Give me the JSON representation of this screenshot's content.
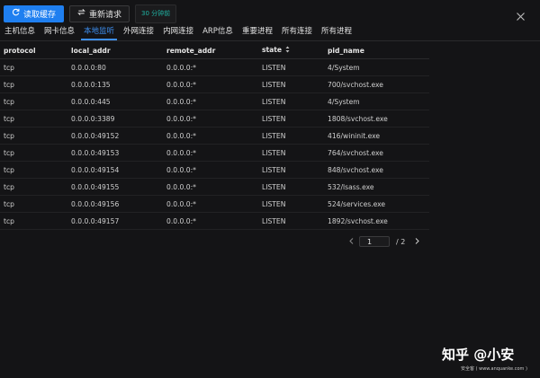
{
  "toolbar": {
    "read_cache_label": "读取缓存",
    "resend_label": "重新请求",
    "time_badge": "30 分钟前"
  },
  "tabs": [
    {
      "label": "主机信息"
    },
    {
      "label": "网卡信息"
    },
    {
      "label": "本地监听",
      "active": true
    },
    {
      "label": "外网连接"
    },
    {
      "label": "内网连接"
    },
    {
      "label": "ARP信息"
    },
    {
      "label": "重要进程"
    },
    {
      "label": "所有连接"
    },
    {
      "label": "所有进程"
    }
  ],
  "table": {
    "headers": {
      "protocol": "protocol",
      "local_addr": "local_addr",
      "remote_addr": "remote_addr",
      "state": "state",
      "pid_name": "pid_name"
    },
    "rows": [
      [
        "tcp",
        "0.0.0.0:80",
        "0.0.0.0:*",
        "LISTEN",
        "4/System"
      ],
      [
        "tcp",
        "0.0.0.0:135",
        "0.0.0.0:*",
        "LISTEN",
        "700/svchost.exe"
      ],
      [
        "tcp",
        "0.0.0.0:445",
        "0.0.0.0:*",
        "LISTEN",
        "4/System"
      ],
      [
        "tcp",
        "0.0.0.0:3389",
        "0.0.0.0:*",
        "LISTEN",
        "1808/svchost.exe"
      ],
      [
        "tcp",
        "0.0.0.0:49152",
        "0.0.0.0:*",
        "LISTEN",
        "416/wininit.exe"
      ],
      [
        "tcp",
        "0.0.0.0:49153",
        "0.0.0.0:*",
        "LISTEN",
        "764/svchost.exe"
      ],
      [
        "tcp",
        "0.0.0.0:49154",
        "0.0.0.0:*",
        "LISTEN",
        "848/svchost.exe"
      ],
      [
        "tcp",
        "0.0.0.0:49155",
        "0.0.0.0:*",
        "LISTEN",
        "532/lsass.exe"
      ],
      [
        "tcp",
        "0.0.0.0:49156",
        "0.0.0.0:*",
        "LISTEN",
        "524/services.exe"
      ],
      [
        "tcp",
        "0.0.0.0:49157",
        "0.0.0.0:*",
        "LISTEN",
        "1892/svchost.exe"
      ]
    ]
  },
  "pagination": {
    "current_page": "1",
    "total_pages": "/ 2"
  },
  "watermark": {
    "main": "知乎 @小安",
    "sub": "安全客 ( www.anquanke.com )"
  },
  "icons": {
    "refresh": "refresh-icon",
    "resend": "exchange-icon",
    "close": "close-icon",
    "sort": "sort-icon",
    "prev": "chevron-left-icon",
    "next": "chevron-right-icon"
  },
  "colors": {
    "accent": "#1f7ff0",
    "active_tab": "#3e8ff0",
    "badge_text": "#1fb5a5",
    "background": "#141416"
  }
}
